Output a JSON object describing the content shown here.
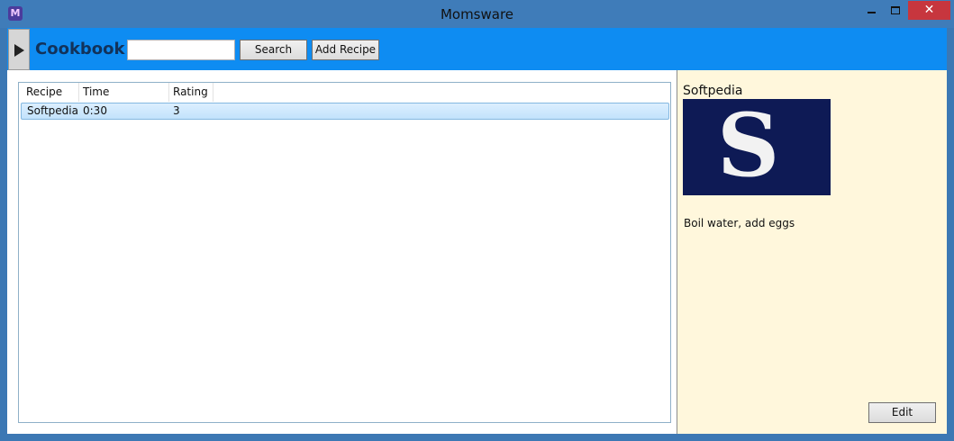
{
  "window": {
    "title": "Momsware",
    "icon_letter": "M",
    "close_glyph": "✕"
  },
  "toolbar": {
    "app_title": "Cookbook",
    "search_value": "",
    "search_label": "Search",
    "add_recipe_label": "Add Recipe"
  },
  "list": {
    "columns": [
      "Recipe",
      "Time",
      "Rating"
    ],
    "rows": [
      {
        "recipe": "Softpedia",
        "time": "0:30",
        "rating": "3"
      }
    ]
  },
  "detail": {
    "title": "Softpedia",
    "logo_letter": "S",
    "instructions": "Boil water, add eggs",
    "edit_label": "Edit"
  },
  "colors": {
    "toolbar": "#0e8cf2",
    "titlebar": "#3f7cb9",
    "detail_bg": "#fff7dc",
    "close": "#c7363e"
  }
}
